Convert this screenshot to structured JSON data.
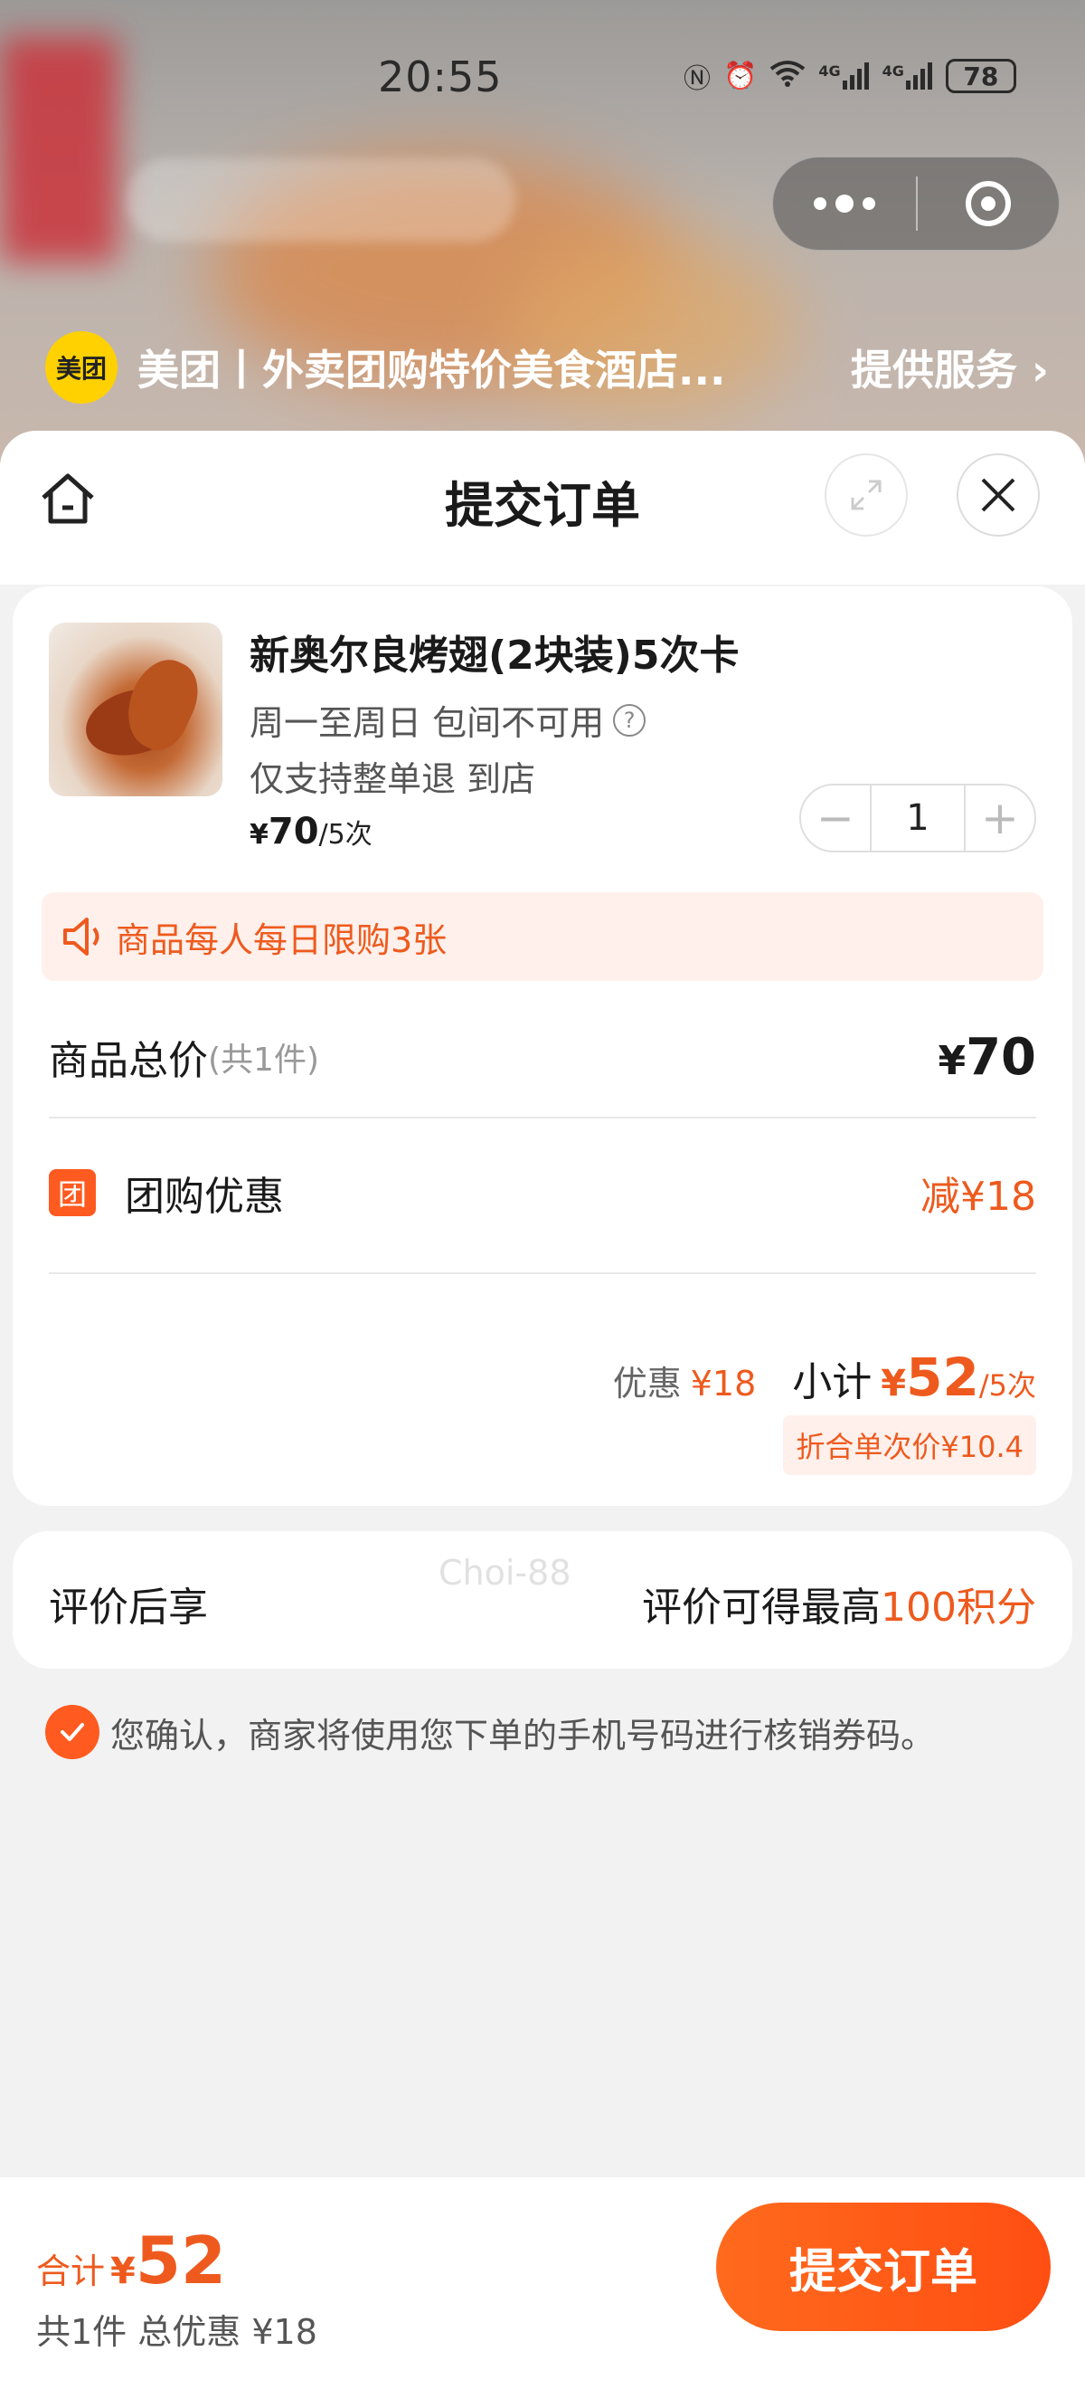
{
  "status_bar": {
    "time": "20:55",
    "battery": "78",
    "network_1": "4G",
    "network_2": "4G"
  },
  "mini_program": {
    "logo_text": "美团",
    "title": "美团丨外卖团购特价美食酒店...",
    "service_link": "提供服务"
  },
  "sheet": {
    "title": "提交订单"
  },
  "product": {
    "name": "新奥尔良烤翅(2块装)5次卡",
    "availability": "周一至周日 包间不可用",
    "refund": "仅支持整单退 到店",
    "price_symbol": "¥",
    "price": "70",
    "price_unit": "/5次",
    "quantity": "1"
  },
  "notice": "商品每人每日限购3张",
  "summary": {
    "total_label": "商品总价",
    "total_count": "(共1件)",
    "total_symbol": "¥",
    "total_value": "70",
    "group_badge": "团",
    "group_label": "团购优惠",
    "group_value": "减¥18",
    "discount_label": "优惠",
    "discount_value": "¥18",
    "subtotal_label": "小计",
    "subtotal_symbol": "¥",
    "subtotal_value": "52",
    "subtotal_unit": "/5次",
    "per_price": "折合单次价¥10.4"
  },
  "review": {
    "label": "评价后享",
    "text": "评价可得最高",
    "points": "100积分"
  },
  "confirm_text": "您确认，商家将使用您下单的手机号码进行核销券码。",
  "watermark": "Choi-88",
  "bottom": {
    "sum_label": "合计",
    "sum_symbol": "¥",
    "sum_value": "52",
    "sum_sub": "共1件 总优惠 ¥18",
    "submit_label": "提交订单"
  },
  "colors": {
    "accent": "#ee5a1e",
    "button": "#ff5a1f",
    "meituan_yellow": "#ffd100"
  }
}
